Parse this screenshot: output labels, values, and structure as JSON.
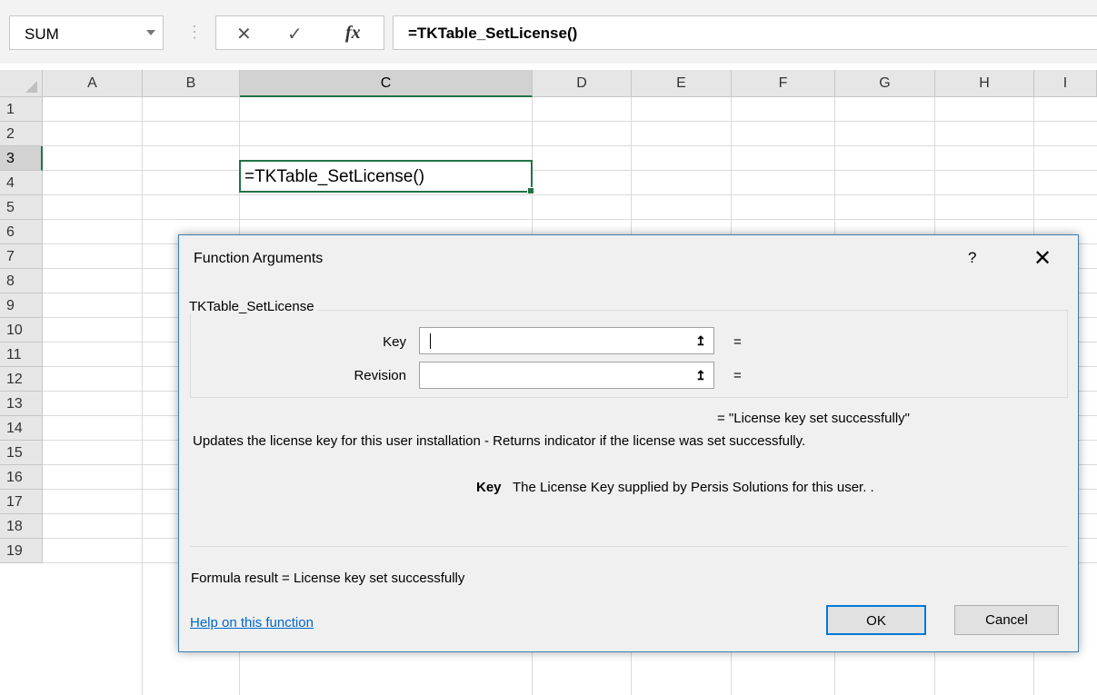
{
  "formula_bar": {
    "name_box": "SUM",
    "cancel_glyph": "✕",
    "enter_glyph": "✓",
    "fx_glyph": "fx",
    "formula": "=TKTable_SetLicense()"
  },
  "grid": {
    "columns": [
      "A",
      "B",
      "C",
      "D",
      "E",
      "F",
      "G",
      "H",
      "I"
    ],
    "rows": [
      "1",
      "2",
      "3",
      "4",
      "5",
      "6",
      "7",
      "8",
      "9",
      "10",
      "11",
      "12",
      "13",
      "14",
      "15",
      "16",
      "17",
      "18",
      "19"
    ],
    "active_column": "C",
    "active_row": "3",
    "active_cell_value": "=TKTable_SetLicense()",
    "accent_color": "#217346"
  },
  "dialog": {
    "title": "Function Arguments",
    "help_glyph": "?",
    "close_glyph": "✕",
    "function_name": "TKTable_SetLicense",
    "args": [
      {
        "label": "Key",
        "value": "",
        "equals": "="
      },
      {
        "label": "Revision",
        "value": "",
        "equals": "="
      }
    ],
    "ref_button_glyph": "↥",
    "result_preview": "=  \"License key set successfully\"",
    "description": "Updates the license key for this user installation - Returns indicator if the license was set successfully.",
    "arg_description_name": "Key",
    "arg_description_text": "The License Key supplied by Persis Solutions for this user. .",
    "formula_result": "Formula result =   License key set successfully",
    "help_link": "Help on this function",
    "ok_label": "OK",
    "cancel_label": "Cancel"
  }
}
